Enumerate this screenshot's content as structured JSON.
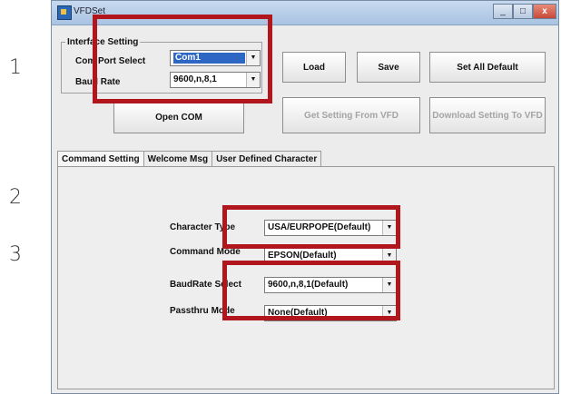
{
  "steps": [
    "1",
    "2",
    "3"
  ],
  "window": {
    "title": "VFDSet",
    "controls": [
      "_",
      "□",
      "x"
    ]
  },
  "interface": {
    "group_title": "Interface Setting",
    "com_port_label": "Com Port Select",
    "com_port_value": "Com1",
    "baud_label": "Baud Rate",
    "baud_value": "9600,n,8,1",
    "open_com": "Open COM"
  },
  "buttons": {
    "load": "Load",
    "save": "Save",
    "set_all_default": "Set All Default",
    "get_setting": "Get Setting From VFD",
    "download_setting": "Download Setting To VFD"
  },
  "tabs": [
    "Command Setting",
    "Welcome Msg",
    "User Defined Character"
  ],
  "settings": [
    {
      "label": "Character Type",
      "value": "USA/EURPOPE(Default)"
    },
    {
      "label": "Command Mode",
      "value": "EPSON(Default)"
    },
    {
      "label": "BaudRate Select",
      "value": "9600,n,8,1(Default)"
    },
    {
      "label": "Passthru Mode",
      "value": "None(Default)"
    }
  ],
  "icons": {
    "dropdown": "chevron-down-icon",
    "app": "app-icon"
  },
  "colors": {
    "highlight": "#b0161c",
    "selection": "#2d66c3"
  }
}
